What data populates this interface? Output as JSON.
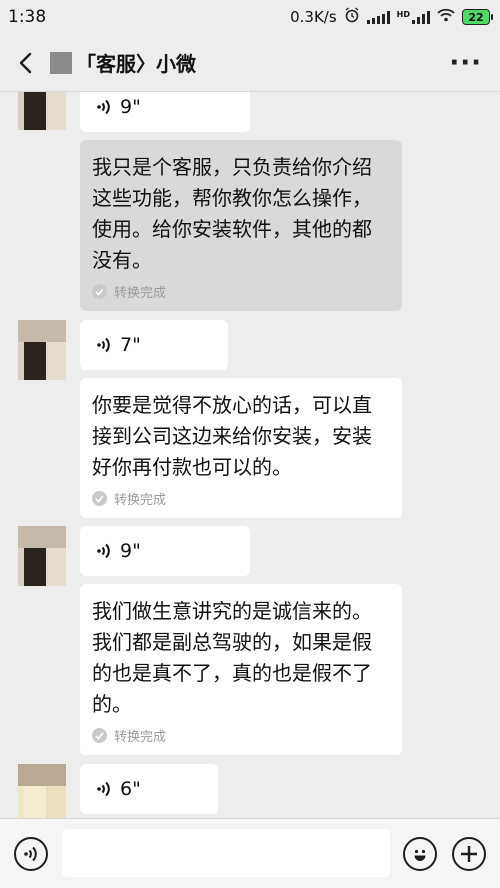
{
  "status_bar": {
    "time": "1:38",
    "net_speed": "0.3K/s",
    "battery": "22",
    "hd_label": "HD"
  },
  "header": {
    "title": "「客服〉小微",
    "back_icon": "chevron-left-icon",
    "more_icon": "more-dots-icon",
    "more_glyph": "···"
  },
  "messages": [
    {
      "type": "voice",
      "duration": "9\""
    },
    {
      "type": "text",
      "highlighted": true,
      "text": "我只是个客服，只负责给你介绍这些功能，帮你教你怎么操作，使用。给你安装软件，其他的都没有。",
      "status": "转换完成"
    },
    {
      "type": "voice",
      "duration": "7\""
    },
    {
      "type": "text",
      "highlighted": false,
      "text": "你要是觉得不放心的话，可以直接到公司这边来给你安装，安装好你再付款也可以的。",
      "status": "转换完成"
    },
    {
      "type": "voice",
      "duration": "9\""
    },
    {
      "type": "text",
      "highlighted": false,
      "text": "我们做生意讲究的是诚信来的。我们都是副总驾驶的，如果是假的也是真不了，真的也是假不了的。",
      "status": "转换完成"
    },
    {
      "type": "voice",
      "duration": "6\""
    }
  ],
  "input_bar": {
    "voice_icon": "voice-mode-icon",
    "emoji_icon": "emoji-icon",
    "plus_icon": "plus-icon"
  },
  "colors": {
    "background": "#ededed",
    "bubble": "#ffffff",
    "highlighted_bubble": "#d9d9d9",
    "status_text": "#9a9a9a"
  }
}
